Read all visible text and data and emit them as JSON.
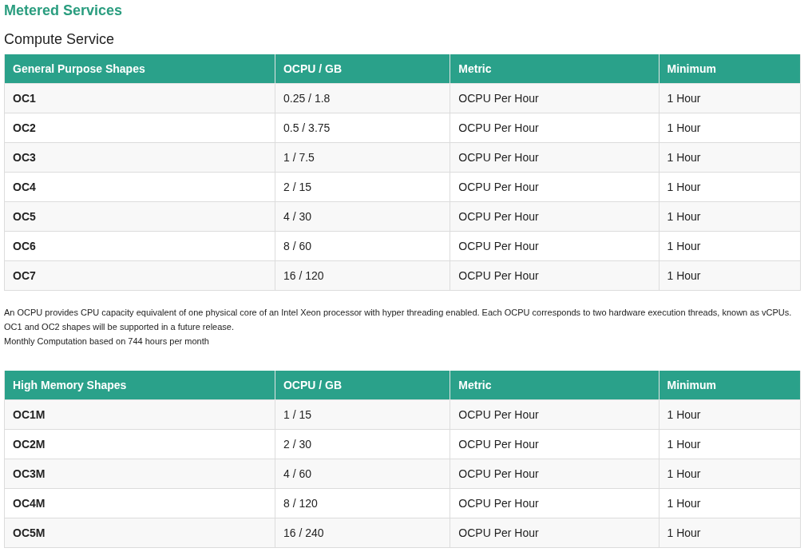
{
  "title": "Metered Services",
  "subtitle": "Compute Service",
  "tables": [
    {
      "columns": [
        "General Purpose Shapes",
        "OCPU / GB",
        "Metric",
        "Minimum"
      ],
      "rows": [
        [
          "OC1",
          "0.25 / 1.8",
          "OCPU Per Hour",
          "1 Hour"
        ],
        [
          "OC2",
          "0.5 / 3.75",
          "OCPU Per Hour",
          "1 Hour"
        ],
        [
          "OC3",
          "1 / 7.5",
          "OCPU Per Hour",
          "1 Hour"
        ],
        [
          "OC4",
          "2 / 15",
          "OCPU Per Hour",
          "1 Hour"
        ],
        [
          "OC5",
          "4 / 30",
          "OCPU Per Hour",
          "1 Hour"
        ],
        [
          "OC6",
          "8 / 60",
          "OCPU Per Hour",
          "1 Hour"
        ],
        [
          "OC7",
          "16 / 120",
          "OCPU Per Hour",
          "1 Hour"
        ]
      ],
      "notes": [
        "An OCPU provides CPU capacity equivalent of one physical core of an Intel Xeon processor with hyper threading enabled. Each OCPU corresponds to two hardware execution threads, known as vCPUs.",
        "OC1 and OC2 shapes will be supported in a future release.",
        "Monthly Computation based on 744 hours per month"
      ]
    },
    {
      "columns": [
        "High Memory Shapes",
        "OCPU / GB",
        "Metric",
        "Minimum"
      ],
      "rows": [
        [
          "OC1M",
          "1 / 15",
          "OCPU Per Hour",
          "1 Hour"
        ],
        [
          "OC2M",
          "2 / 30",
          "OCPU Per Hour",
          "1 Hour"
        ],
        [
          "OC3M",
          "4 / 60",
          "OCPU Per Hour",
          "1 Hour"
        ],
        [
          "OC4M",
          "8 / 120",
          "OCPU Per Hour",
          "1 Hour"
        ],
        [
          "OC5M",
          "16 / 240",
          "OCPU Per Hour",
          "1 Hour"
        ]
      ]
    }
  ]
}
